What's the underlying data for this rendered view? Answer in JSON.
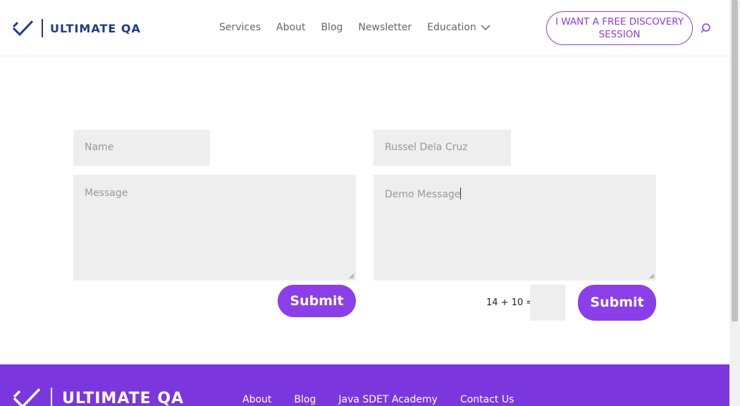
{
  "header": {
    "logo_text": "ULTIMATE QA",
    "nav": [
      "Services",
      "About",
      "Blog",
      "Newsletter",
      "Education"
    ],
    "cta": "I WANT A FREE DISCOVERY SESSION",
    "icons": {
      "search": "search-icon",
      "chevron": "chevron-down-icon"
    }
  },
  "form_left": {
    "name_placeholder": "Name",
    "message_placeholder": "Message",
    "submit_label": "Submit"
  },
  "form_right": {
    "name_value": "Russel Dela Cruz",
    "message_value": "Demo Message",
    "captcha_text": "14 + 10 =",
    "captcha_value": "",
    "submit_label": "Submit"
  },
  "footer": {
    "logo_text": "ULTIMATE QA",
    "links": [
      "About",
      "Blog",
      "Java SDET Academy",
      "Contact Us"
    ]
  },
  "colors": {
    "brand_purple": "#8a3fe8",
    "footer_purple": "#7b36de",
    "logo_blue": "#1f3a8a",
    "field_bg": "#eeeeee"
  }
}
